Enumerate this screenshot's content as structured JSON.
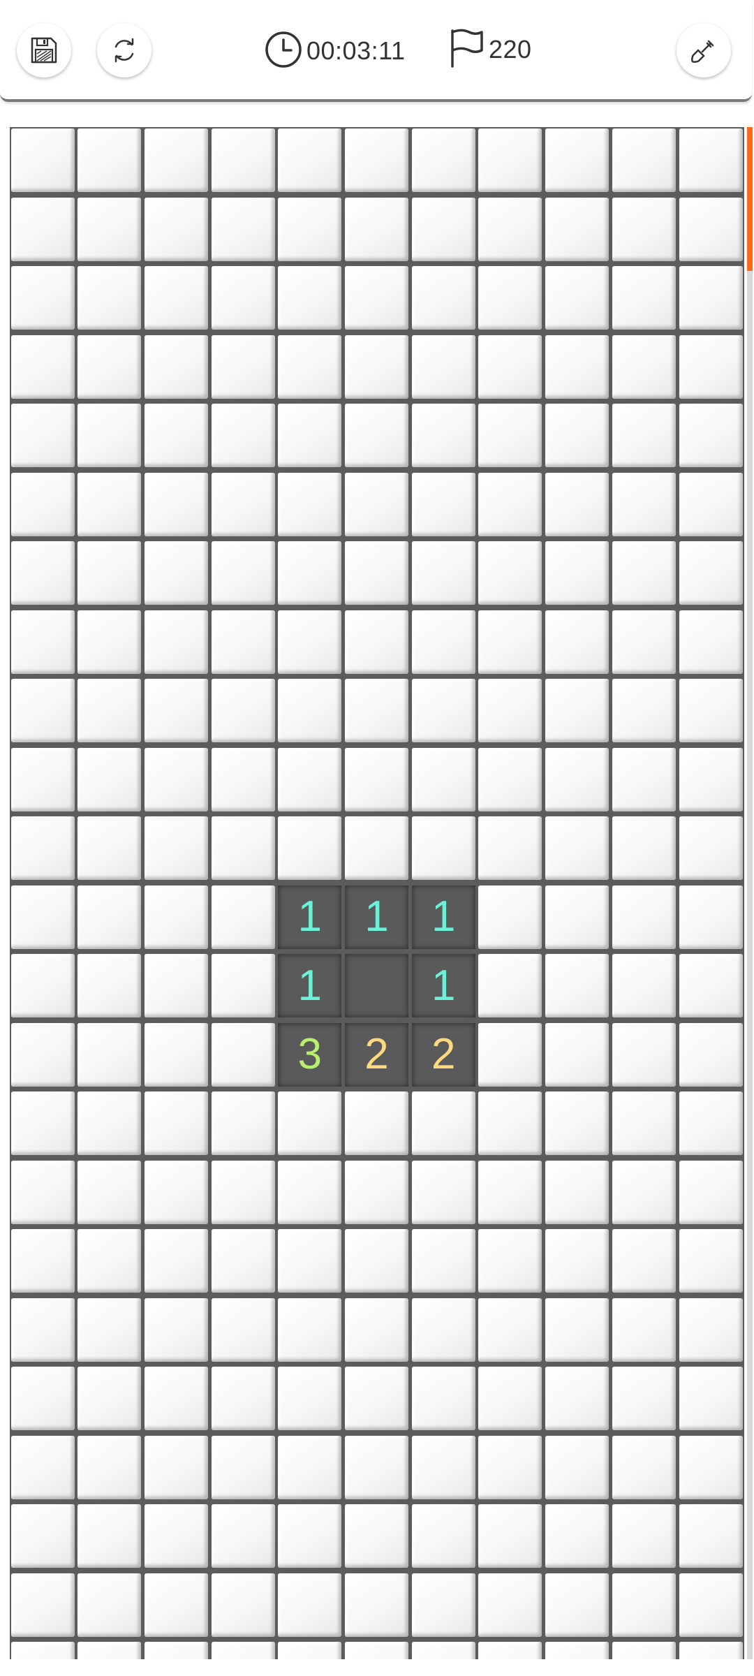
{
  "header": {
    "timer": "00:03:11",
    "flags": "220",
    "icons": {
      "save": "floppy-disk",
      "restart": "refresh-arrows",
      "timer": "clock",
      "flags": "flag",
      "tool": "shovel"
    }
  },
  "board": {
    "cols": 11,
    "rows": 23,
    "revealed": [
      {
        "row": 11,
        "col": 4,
        "value": "1"
      },
      {
        "row": 11,
        "col": 5,
        "value": "1"
      },
      {
        "row": 11,
        "col": 6,
        "value": "1"
      },
      {
        "row": 12,
        "col": 4,
        "value": "1"
      },
      {
        "row": 12,
        "col": 5,
        "value": ""
      },
      {
        "row": 12,
        "col": 6,
        "value": "1"
      },
      {
        "row": 13,
        "col": 4,
        "value": "3"
      },
      {
        "row": 13,
        "col": 5,
        "value": "2"
      },
      {
        "row": 13,
        "col": 6,
        "value": "2"
      }
    ],
    "number_colors": {
      "1": "#6ef0d8",
      "2": "#ffd980",
      "3": "#b8f06e"
    }
  },
  "colors": {
    "accent": "#ff6a1a",
    "grid": "#5c5c5c"
  },
  "scroll": {
    "position": 0
  }
}
